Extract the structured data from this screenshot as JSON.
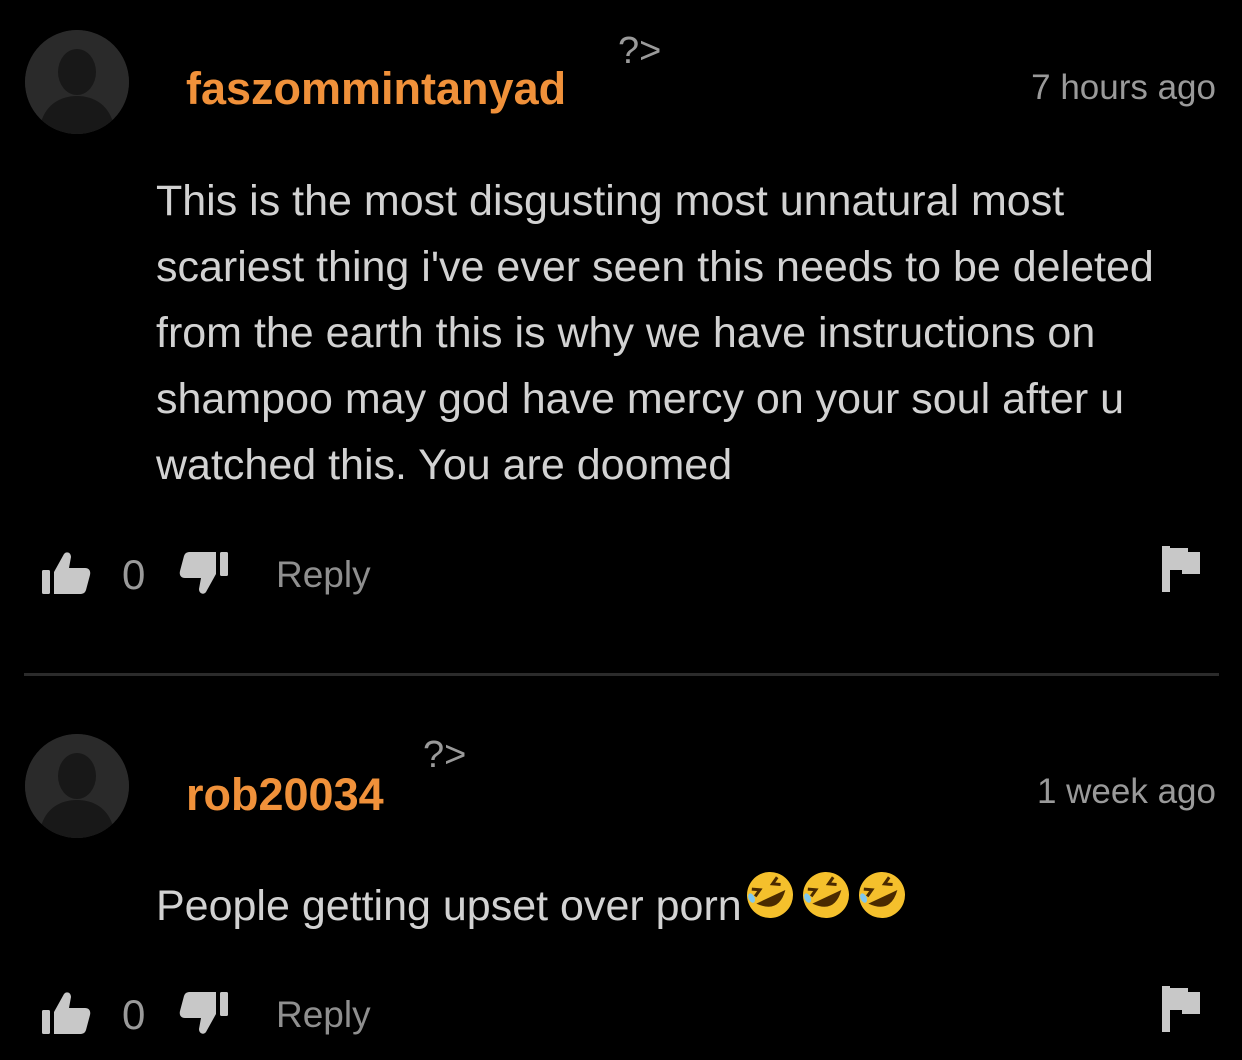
{
  "comments": [
    {
      "username": "faszommintanyad",
      "badge": "?>",
      "timestamp": "7 hours ago",
      "text": "This is the most disgusting most unnatural most scariest thing i've ever seen this needs to be deleted from the earth this is why we have instructions on shampoo may god have mercy on your soul after u watched this. You are doomed",
      "votes": "0",
      "reply_label": "Reply"
    },
    {
      "username": "rob20034",
      "badge": "?>",
      "timestamp": "1 week ago",
      "text": "People getting upset over porn",
      "emoji": "rolling-on-floor-laughing x3",
      "votes": "0",
      "reply_label": "Reply"
    }
  ],
  "colors": {
    "background": "#000000",
    "username": "#f0913a",
    "body_text": "#d2d2d2",
    "muted": "#9a9a9a",
    "divider": "#2b2b2b",
    "avatar_bg": "#2a2a2a"
  },
  "icons": [
    "avatar-placeholder-icon",
    "thumbs-up-icon",
    "thumbs-down-icon",
    "flag-icon",
    "rofl-emoji-icon"
  ]
}
